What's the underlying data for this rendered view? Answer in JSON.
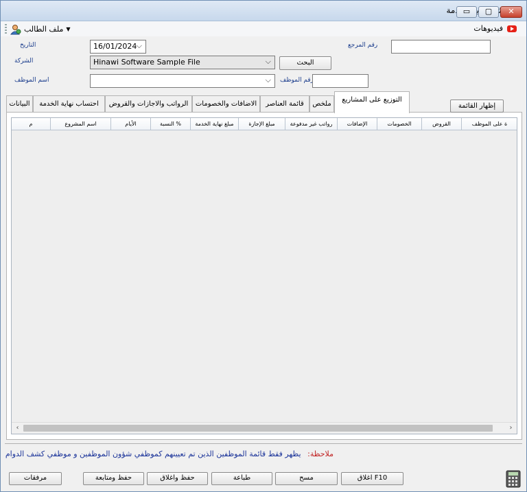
{
  "window": {
    "title": "إنشاء نهاية الخدمة",
    "minimize_label": "▭",
    "maximize_label": "▢",
    "close_label": "✕"
  },
  "menubar": {
    "student_file": "ملف الطالب",
    "videos": "فيديوهات"
  },
  "form": {
    "date_label": "التاريخ",
    "date_value": "16/01/2024",
    "reference_label": "رقم المرجع",
    "reference_value": "",
    "company_label": "الشركة",
    "company_value": "Hinawi Software Sample File",
    "search_button": "البحث",
    "employee_name_label": "اسم الموظف",
    "employee_name_value": "",
    "employee_no_label": "رقم الموظف",
    "employee_no_value": ""
  },
  "tabs": [
    {
      "label": "البيانات",
      "active": false
    },
    {
      "label": "احتساب نهاية الخدمة",
      "active": false
    },
    {
      "label": "الرواتب والاجازات والقروض",
      "active": false
    },
    {
      "label": "الاضافات والخصومات",
      "active": false
    },
    {
      "label": "قائمة العناصر",
      "active": false
    },
    {
      "label": "ملخص",
      "active": false
    },
    {
      "label": "التوزيع على المشاريع",
      "active": true
    }
  ],
  "show_list_button": "إظهار القائمة",
  "grid": {
    "columns": [
      "ة على الموظف",
      "القروض",
      "الخصومات",
      "الإضافات",
      "رواتب غير مدفوعة",
      "مبلغ الإجازة",
      "مبلغ نهاية الخدمة",
      "% النسبة",
      "الأيام",
      "اسم المشروع",
      "م"
    ],
    "rows": []
  },
  "note": {
    "label": "ملاحظة:",
    "text": "يظهر فقط قائمة الموظفين الذين تم تعيينهم كموظفي شؤون الموظفين و موظفي كشف الدوام"
  },
  "bottom_buttons": {
    "attachments": "مرفقات",
    "save_continue": "حفظ ومتابعة",
    "save_close": "حفظ واغلاق",
    "print": "طباعة",
    "clear": "مسح",
    "close": "F10 اغلاق"
  }
}
